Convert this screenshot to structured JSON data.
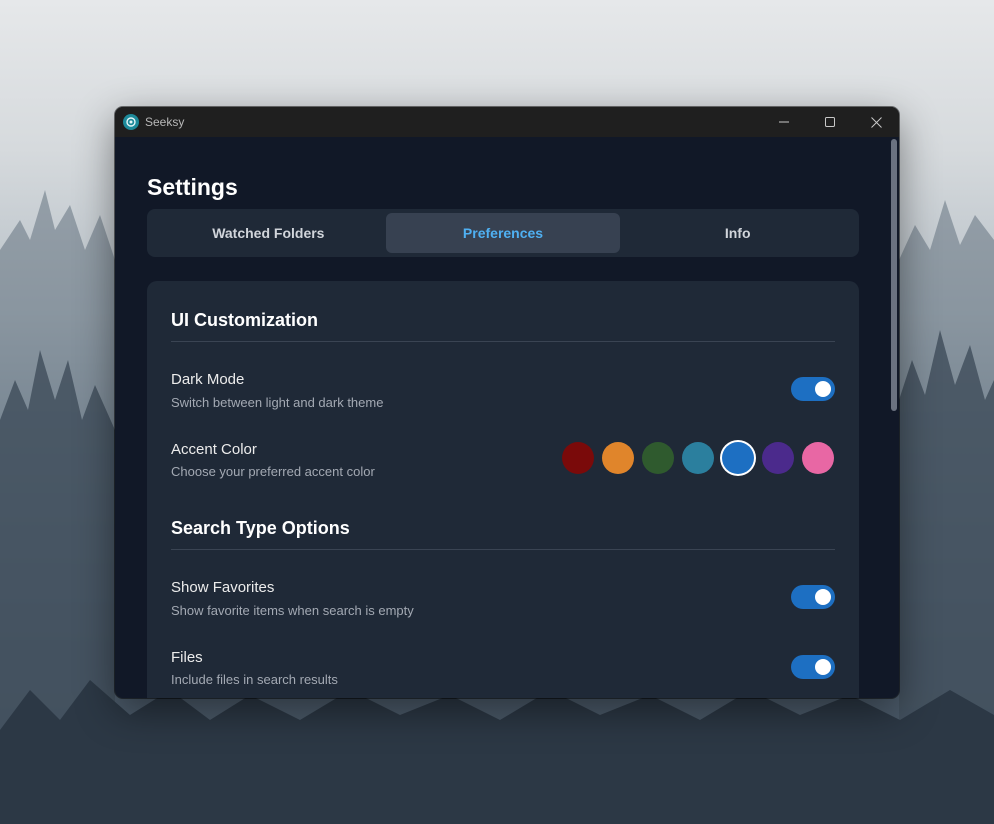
{
  "window": {
    "app_title": "Seeksy",
    "app_icon": "seeksy-logo-icon",
    "controls": [
      "minimize-icon",
      "maximize-icon",
      "close-icon"
    ]
  },
  "page": {
    "title": "Settings"
  },
  "tabs": [
    {
      "label": "Watched Folders",
      "active": false
    },
    {
      "label": "Preferences",
      "active": true
    },
    {
      "label": "Info",
      "active": false
    }
  ],
  "ui_customization": {
    "title": "UI Customization",
    "dark_mode": {
      "label": "Dark Mode",
      "description": "Switch between light and dark theme",
      "enabled": true
    },
    "accent_color": {
      "label": "Accent Color",
      "description": "Choose your preferred accent color",
      "options": [
        "#7a0a0a",
        "#e0852b",
        "#2f5a2e",
        "#2b7f9e",
        "#1d6fc2",
        "#4b2a8c",
        "#e867a4"
      ],
      "selected": "#1d6fc2"
    }
  },
  "search_type_options": {
    "title": "Search Type Options",
    "show_favorites": {
      "label": "Show Favorites",
      "description": "Show favorite items when search is empty",
      "enabled": true
    },
    "files": {
      "label": "Files",
      "description": "Include files in search results",
      "enabled": true
    }
  },
  "colors": {
    "accent": "#4fb0f2",
    "toggle_on": "#1d6fc2",
    "background": "#111827",
    "card": "#1f2937"
  }
}
